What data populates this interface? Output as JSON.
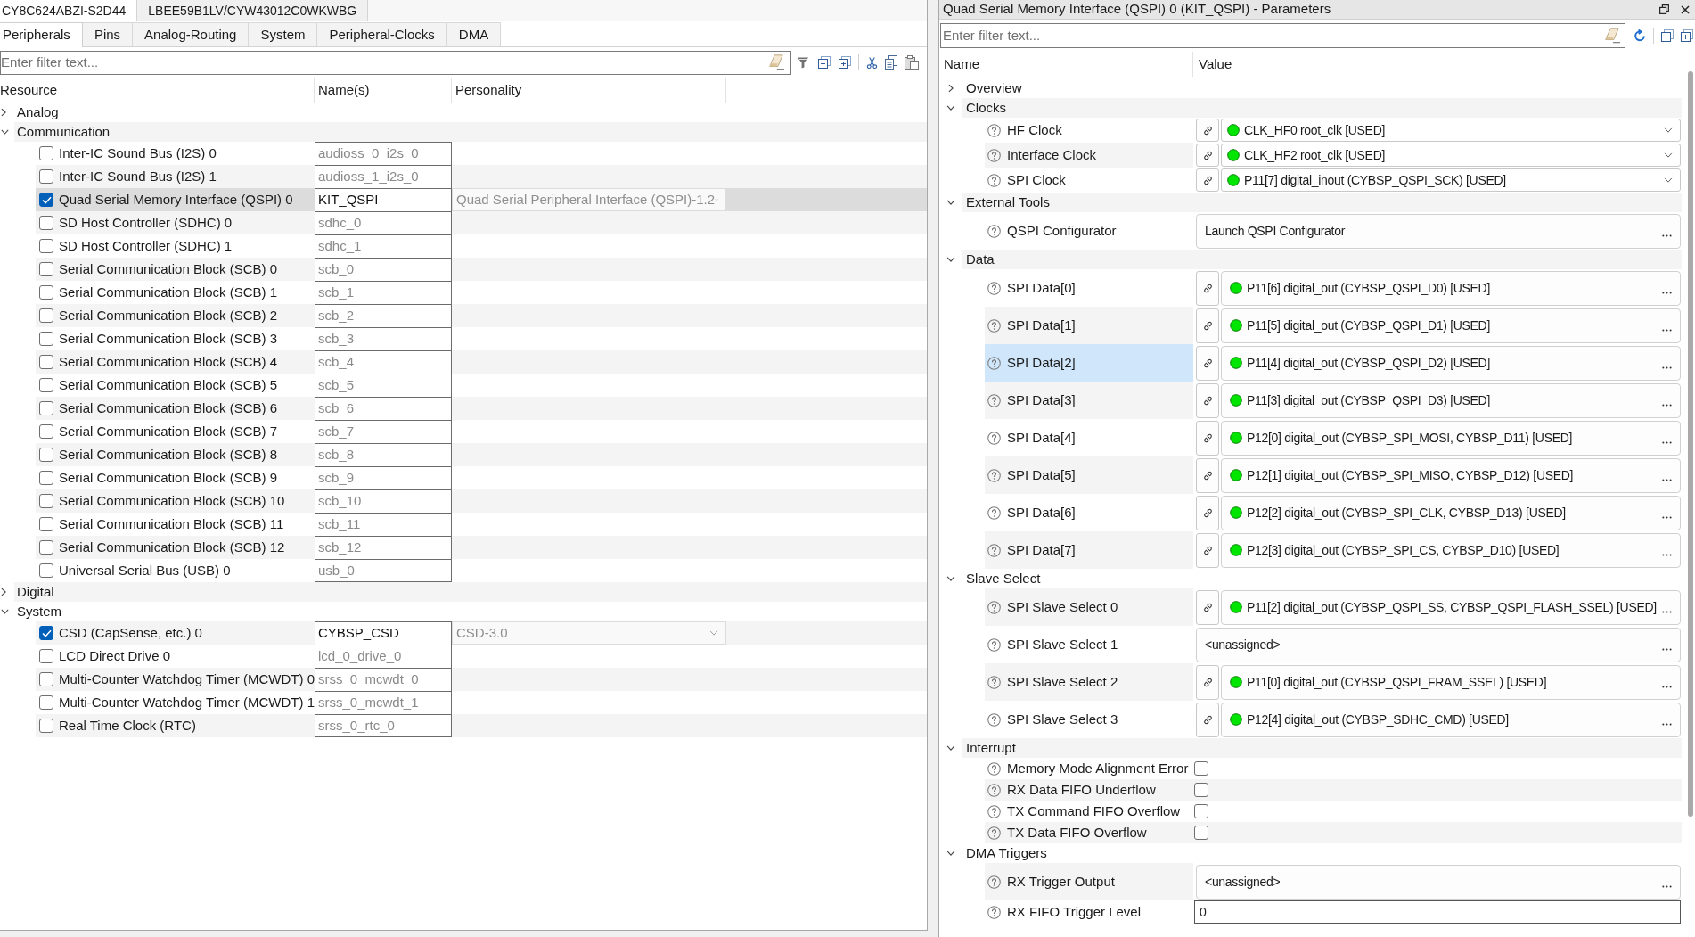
{
  "editor_tabs": [
    {
      "label": "CY8C624ABZI-S2D44",
      "selected": true
    },
    {
      "label": "LBEE59B1LV/CYW43012C0WKWBG",
      "selected": false
    }
  ],
  "tabs": [
    {
      "label": "Peripherals",
      "selected": true
    },
    {
      "label": "Pins",
      "selected": false
    },
    {
      "label": "Analog-Routing",
      "selected": false
    },
    {
      "label": "System",
      "selected": false
    },
    {
      "label": "Peripheral-Clocks",
      "selected": false
    },
    {
      "label": "DMA",
      "selected": false
    }
  ],
  "resources": {
    "filter": {
      "placeholder": "Enter filter text..."
    },
    "columns": [
      "Resource",
      "Name(s)",
      "Personality"
    ],
    "groups": [
      {
        "label": "Analog",
        "expanded": false
      },
      {
        "label": "Communication",
        "expanded": true,
        "children": [
          {
            "label": "Inter-IC Sound Bus (I2S) 0",
            "name": "audioss_0_i2s_0",
            "checked": false,
            "selected": false
          },
          {
            "label": "Inter-IC Sound Bus (I2S) 1",
            "name": "audioss_1_i2s_0",
            "checked": false,
            "selected": false
          },
          {
            "label": "Quad Serial Memory Interface (QSPI) 0",
            "name": "KIT_QSPI",
            "personality": "Quad Serial Peripheral Interface (QSPI)-1.2",
            "checked": true,
            "selected": true
          },
          {
            "label": "SD Host Controller (SDHC) 0",
            "name": "sdhc_0",
            "checked": false,
            "selected": false
          },
          {
            "label": "SD Host Controller (SDHC) 1",
            "name": "sdhc_1",
            "checked": false,
            "selected": false
          },
          {
            "label": "Serial Communication Block (SCB) 0",
            "name": "scb_0",
            "checked": false,
            "selected": false
          },
          {
            "label": "Serial Communication Block (SCB) 1",
            "name": "scb_1",
            "checked": false,
            "selected": false
          },
          {
            "label": "Serial Communication Block (SCB) 2",
            "name": "scb_2",
            "checked": false,
            "selected": false
          },
          {
            "label": "Serial Communication Block (SCB) 3",
            "name": "scb_3",
            "checked": false,
            "selected": false
          },
          {
            "label": "Serial Communication Block (SCB) 4",
            "name": "scb_4",
            "checked": false,
            "selected": false
          },
          {
            "label": "Serial Communication Block (SCB) 5",
            "name": "scb_5",
            "checked": false,
            "selected": false
          },
          {
            "label": "Serial Communication Block (SCB) 6",
            "name": "scb_6",
            "checked": false,
            "selected": false
          },
          {
            "label": "Serial Communication Block (SCB) 7",
            "name": "scb_7",
            "checked": false,
            "selected": false
          },
          {
            "label": "Serial Communication Block (SCB) 8",
            "name": "scb_8",
            "checked": false,
            "selected": false
          },
          {
            "label": "Serial Communication Block (SCB) 9",
            "name": "scb_9",
            "checked": false,
            "selected": false
          },
          {
            "label": "Serial Communication Block (SCB) 10",
            "name": "scb_10",
            "checked": false,
            "selected": false
          },
          {
            "label": "Serial Communication Block (SCB) 11",
            "name": "scb_11",
            "checked": false,
            "selected": false
          },
          {
            "label": "Serial Communication Block (SCB) 12",
            "name": "scb_12",
            "checked": false,
            "selected": false
          },
          {
            "label": "Universal Serial Bus (USB) 0",
            "name": "usb_0",
            "checked": false,
            "selected": false
          }
        ]
      },
      {
        "label": "Digital",
        "expanded": false
      },
      {
        "label": "System",
        "expanded": true,
        "children": [
          {
            "label": "CSD (CapSense, etc.) 0",
            "name": "CYBSP_CSD",
            "personality": "CSD-3.0",
            "checked": true,
            "selected": false
          },
          {
            "label": "LCD Direct Drive 0",
            "name": "lcd_0_drive_0",
            "checked": false,
            "selected": false
          },
          {
            "label": "Multi-Counter Watchdog Timer (MCWDT) 0",
            "name": "srss_0_mcwdt_0",
            "checked": false,
            "selected": false
          },
          {
            "label": "Multi-Counter Watchdog Timer (MCWDT) 1",
            "name": "srss_0_mcwdt_1",
            "checked": false,
            "selected": false
          },
          {
            "label": "Real Time Clock (RTC)",
            "name": "srss_0_rtc_0",
            "checked": false,
            "selected": false
          }
        ]
      }
    ]
  },
  "parameters": {
    "title": "Quad Serial Memory Interface (QSPI) 0 (KIT_QSPI) - Parameters",
    "filter": {
      "placeholder": "Enter filter text..."
    },
    "columns": [
      "Name",
      "Value"
    ],
    "groups": [
      {
        "label": "Overview",
        "expanded": false
      },
      {
        "label": "Clocks",
        "expanded": true,
        "children": [
          {
            "kind": "dropdown",
            "label": "HF Clock",
            "linked": true,
            "value": "CLK_HF0 root_clk [USED]",
            "selected": false
          },
          {
            "kind": "dropdown",
            "label": "Interface Clock",
            "linked": true,
            "value": "CLK_HF2 root_clk [USED]",
            "selected": false
          },
          {
            "kind": "dropdown",
            "label": "SPI Clock",
            "linked": true,
            "value": "P11[7] digital_inout (CYBSP_QSPI_SCK) [USED]",
            "selected": false
          }
        ]
      },
      {
        "label": "External Tools",
        "expanded": true,
        "children": [
          {
            "kind": "picker",
            "label": "QSPI Configurator",
            "linked": false,
            "value": "Launch QSPI Configurator",
            "selected": false
          }
        ]
      },
      {
        "label": "Data",
        "expanded": true,
        "children": [
          {
            "kind": "picker",
            "label": "SPI Data[0]",
            "linked": true,
            "value": "P11[6] digital_out (CYBSP_QSPI_D0) [USED]",
            "selected": false
          },
          {
            "kind": "picker",
            "label": "SPI Data[1]",
            "linked": true,
            "value": "P11[5] digital_out (CYBSP_QSPI_D1) [USED]",
            "selected": false
          },
          {
            "kind": "picker",
            "label": "SPI Data[2]",
            "linked": true,
            "value": "P11[4] digital_out (CYBSP_QSPI_D2) [USED]",
            "selected": true
          },
          {
            "kind": "picker",
            "label": "SPI Data[3]",
            "linked": true,
            "value": "P11[3] digital_out (CYBSP_QSPI_D3) [USED]",
            "selected": false
          },
          {
            "kind": "picker",
            "label": "SPI Data[4]",
            "linked": true,
            "value": "P12[0] digital_out (CYBSP_SPI_MOSI, CYBSP_D11) [USED]",
            "selected": false
          },
          {
            "kind": "picker",
            "label": "SPI Data[5]",
            "linked": true,
            "value": "P12[1] digital_out (CYBSP_SPI_MISO, CYBSP_D12) [USED]",
            "selected": false
          },
          {
            "kind": "picker",
            "label": "SPI Data[6]",
            "linked": true,
            "value": "P12[2] digital_out (CYBSP_SPI_CLK, CYBSP_D13) [USED]",
            "selected": false
          },
          {
            "kind": "picker",
            "label": "SPI Data[7]",
            "linked": true,
            "value": "P12[3] digital_out (CYBSP_SPI_CS, CYBSP_D10) [USED]",
            "selected": false
          }
        ]
      },
      {
        "label": "Slave Select",
        "expanded": true,
        "children": [
          {
            "kind": "picker",
            "label": "SPI Slave Select 0",
            "linked": true,
            "value": "P11[2] digital_out (CYBSP_QSPI_SS, CYBSP_QSPI_FLASH_SSEL) [USED]",
            "selected": false
          },
          {
            "kind": "picker",
            "label": "SPI Slave Select 1",
            "linked": false,
            "value": "<unassigned>",
            "selected": false
          },
          {
            "kind": "picker",
            "label": "SPI Slave Select 2",
            "linked": true,
            "value": "P11[0] digital_out (CYBSP_QSPI_FRAM_SSEL) [USED]",
            "selected": false
          },
          {
            "kind": "picker",
            "label": "SPI Slave Select 3",
            "linked": true,
            "value": "P12[4] digital_out (CYBSP_SDHC_CMD) [USED]",
            "selected": false
          }
        ]
      },
      {
        "label": "Interrupt",
        "expanded": true,
        "children": [
          {
            "kind": "checkbox",
            "label": "Memory Mode Alignment Error",
            "checked": false,
            "selected": false
          },
          {
            "kind": "checkbox",
            "label": "RX Data FIFO Underflow",
            "checked": false,
            "selected": false
          },
          {
            "kind": "checkbox",
            "label": "TX Command FIFO Overflow",
            "checked": false,
            "selected": false
          },
          {
            "kind": "checkbox",
            "label": "TX Data FIFO Overflow",
            "checked": false,
            "selected": false
          }
        ]
      },
      {
        "label": "DMA Triggers",
        "expanded": true,
        "children": [
          {
            "kind": "picker",
            "label": "RX Trigger Output",
            "linked": false,
            "value": "<unassigned>",
            "selected": false
          },
          {
            "kind": "text",
            "label": "RX FIFO Trigger Level",
            "value": "0",
            "selected": false
          }
        ]
      }
    ]
  }
}
